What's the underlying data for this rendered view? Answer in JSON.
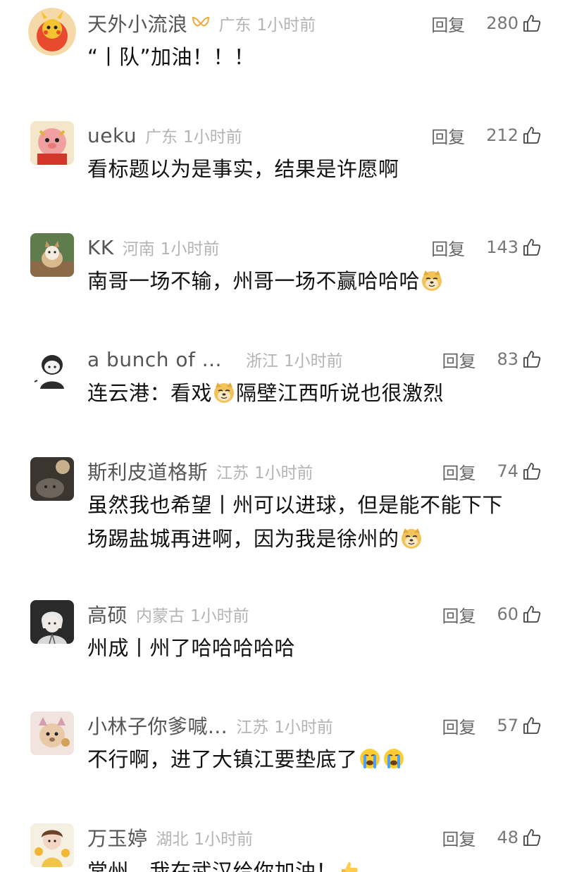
{
  "comments": [
    {
      "user": "天外小流浪",
      "location": "广东",
      "time": "1小时前",
      "reply": "回复",
      "likes": "280",
      "text": [
        "“丨队”加油！！！"
      ],
      "emojis_after": []
    },
    {
      "user": "ueku",
      "location": "广东",
      "time": "1小时前",
      "reply": "回复",
      "likes": "212",
      "text": [
        "看标题以为是事实，结果是许愿啊"
      ],
      "emojis_after": []
    },
    {
      "user": "KK",
      "location": "河南",
      "time": "1小时前",
      "reply": "回复",
      "likes": "143",
      "text": [
        "南哥一场不输，州哥一场不赢哈哈哈"
      ],
      "emojis_after": [
        "doge"
      ]
    },
    {
      "user": "a bunch of ...",
      "location": "浙江",
      "time": "1小时前",
      "reply": "回复",
      "likes": "83",
      "text_a": "连云港：看戏",
      "text_b": "隔壁江西听说也很激烈",
      "emoji_mid": "doge"
    },
    {
      "user": "斯利皮道格斯",
      "location": "江苏",
      "time": "1小时前",
      "reply": "回复",
      "likes": "74",
      "line1": "虽然我也希望丨州可以进球，但是能不能下下",
      "line2": "场踢盐城再进啊，因为我是徐州的",
      "emojis_after": [
        "doge"
      ]
    },
    {
      "user": "高硕",
      "location": "内蒙古",
      "time": "1小时前",
      "reply": "回复",
      "likes": "60",
      "text": [
        "州成丨州了哈哈哈哈哈"
      ],
      "emojis_after": []
    },
    {
      "user": "小林子你爹喊...",
      "location": "江苏",
      "time": "1小时前",
      "reply": "回复",
      "likes": "57",
      "text": [
        "不行啊，进了大镇江要垫底了"
      ],
      "emojis_after": [
        "cry",
        "cry"
      ]
    },
    {
      "user": "万玉婷",
      "location": "湖北",
      "time": "1小时前",
      "reply": "回复",
      "likes": "48",
      "text": [
        "常州，我在武汉给你加油！"
      ],
      "emojis_after": [
        "thumb"
      ]
    }
  ]
}
